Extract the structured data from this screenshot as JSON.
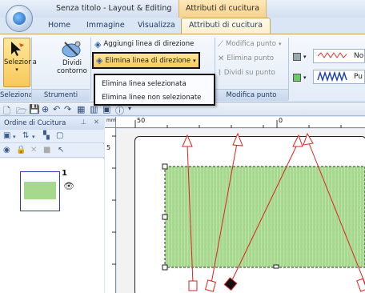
{
  "titlebar": {
    "window_title": "Senza titolo - Layout & Editing",
    "context_group": "Attributi di cucitura"
  },
  "tabs": [
    {
      "label": "Home",
      "active": false
    },
    {
      "label": "Immagine",
      "active": false
    },
    {
      "label": "Visualizza",
      "active": false
    },
    {
      "label": "Attributi di cucitura",
      "active": true
    }
  ],
  "ribbon": {
    "selection_group": {
      "select_label": "Seleziona",
      "split_outline_label": "Dividi contorno",
      "group_labels": [
        "Seleziona",
        "Strumenti"
      ]
    },
    "direction_group": {
      "add_direction_line": "Aggiungi linea di direzione",
      "delete_direction_line": "Elimina linea di direzione",
      "modify_point": "Modifica punto",
      "delete_point": "Elimina punto",
      "split_on_point": "Dividi su punto",
      "group_label": "Modifica punto"
    },
    "stitch_samples": [
      "No",
      "Pu"
    ]
  },
  "dropdown_menu": {
    "items": [
      "Elimina linea selezionata",
      "Elimina linee non selezionate"
    ]
  },
  "left_pane": {
    "title": "Ordine di Cucitura",
    "pin_icon": "pin-icon",
    "close_icon": "close-icon",
    "items": [
      {
        "number": "1",
        "swatch_color": "#a6d98e",
        "visible": true
      }
    ]
  },
  "ruler": {
    "top_unit": "mm",
    "top_labels": [
      "50",
      "0"
    ],
    "left_labels": [
      "5"
    ]
  },
  "design": {
    "fill_color": "#a6d98e",
    "direction_line_color": "#e02020"
  }
}
